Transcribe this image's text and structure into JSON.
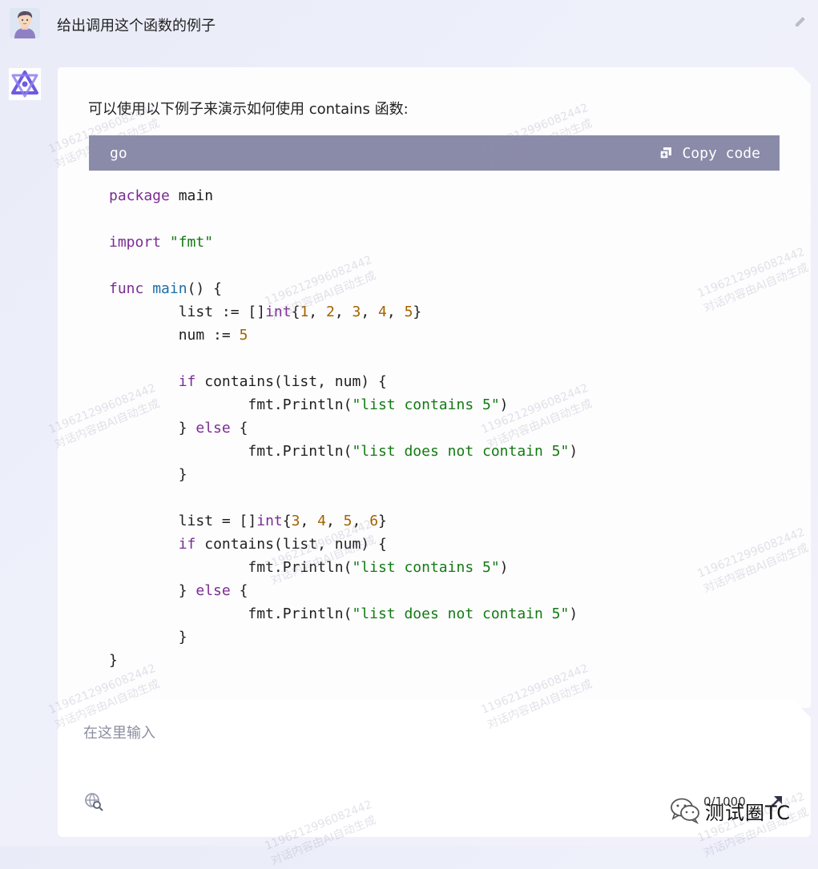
{
  "user": {
    "message": "给出调用这个函数的例子"
  },
  "assistant": {
    "intro": "可以使用以下例子来演示如何使用 contains 函数:",
    "code": {
      "language": "go",
      "copy_label": "Copy code",
      "lines": [
        [
          {
            "t": "package",
            "c": "kw"
          },
          {
            "t": " main"
          }
        ],
        [],
        [
          {
            "t": "import",
            "c": "kw"
          },
          {
            "t": " "
          },
          {
            "t": "\"fmt\"",
            "c": "str"
          }
        ],
        [],
        [
          {
            "t": "func",
            "c": "kw"
          },
          {
            "t": " "
          },
          {
            "t": "main",
            "c": "fn"
          },
          {
            "t": "() {"
          }
        ],
        [
          {
            "t": "        list := []"
          },
          {
            "t": "int",
            "c": "type"
          },
          {
            "t": "{"
          },
          {
            "t": "1",
            "c": "num"
          },
          {
            "t": ", "
          },
          {
            "t": "2",
            "c": "num"
          },
          {
            "t": ", "
          },
          {
            "t": "3",
            "c": "num"
          },
          {
            "t": ", "
          },
          {
            "t": "4",
            "c": "num"
          },
          {
            "t": ", "
          },
          {
            "t": "5",
            "c": "num"
          },
          {
            "t": "}"
          }
        ],
        [
          {
            "t": "        num := "
          },
          {
            "t": "5",
            "c": "num"
          }
        ],
        [],
        [
          {
            "t": "        "
          },
          {
            "t": "if",
            "c": "kw"
          },
          {
            "t": " contains(list, num) {"
          }
        ],
        [
          {
            "t": "                fmt.Println("
          },
          {
            "t": "\"list contains 5\"",
            "c": "str"
          },
          {
            "t": ")"
          }
        ],
        [
          {
            "t": "        } "
          },
          {
            "t": "else",
            "c": "kw"
          },
          {
            "t": " {"
          }
        ],
        [
          {
            "t": "                fmt.Println("
          },
          {
            "t": "\"list does not contain 5\"",
            "c": "str"
          },
          {
            "t": ")"
          }
        ],
        [
          {
            "t": "        }"
          }
        ],
        [],
        [
          {
            "t": "        list = []"
          },
          {
            "t": "int",
            "c": "type"
          },
          {
            "t": "{"
          },
          {
            "t": "3",
            "c": "num"
          },
          {
            "t": ", "
          },
          {
            "t": "4",
            "c": "num"
          },
          {
            "t": ", "
          },
          {
            "t": "5",
            "c": "num"
          },
          {
            "t": ", "
          },
          {
            "t": "6",
            "c": "num"
          },
          {
            "t": "}"
          }
        ],
        [
          {
            "t": "        "
          },
          {
            "t": "if",
            "c": "kw"
          },
          {
            "t": " contains(list, num) {"
          }
        ],
        [
          {
            "t": "                fmt.Println("
          },
          {
            "t": "\"list contains 5\"",
            "c": "str"
          },
          {
            "t": ")"
          }
        ],
        [
          {
            "t": "        } "
          },
          {
            "t": "else",
            "c": "kw"
          },
          {
            "t": " {"
          }
        ],
        [
          {
            "t": "                fmt.Println("
          },
          {
            "t": "\"list does not contain 5\"",
            "c": "str"
          },
          {
            "t": ")"
          }
        ],
        [
          {
            "t": "        }"
          }
        ],
        [
          {
            "t": "}"
          }
        ]
      ]
    }
  },
  "input": {
    "placeholder": "在这里输入",
    "counter": "0/1000"
  },
  "watermark": {
    "line1": "1196212996082442",
    "line2": "对话内容由AI自动生成"
  },
  "brand": {
    "text": "测试圈TC"
  },
  "icons": {
    "user_avatar": "user-avatar-icon",
    "bot_avatar": "bot-logo-icon",
    "edit": "pencil-icon",
    "copy": "copy-icon",
    "web_search": "globe-search-icon",
    "send": "send-arrow-icon",
    "brand": "wechat-icon"
  },
  "colors": {
    "code_header": "#8a8aa9",
    "keyword": "#7a2d92",
    "function": "#1b6fa8",
    "string": "#137a13",
    "number": "#a36200"
  }
}
